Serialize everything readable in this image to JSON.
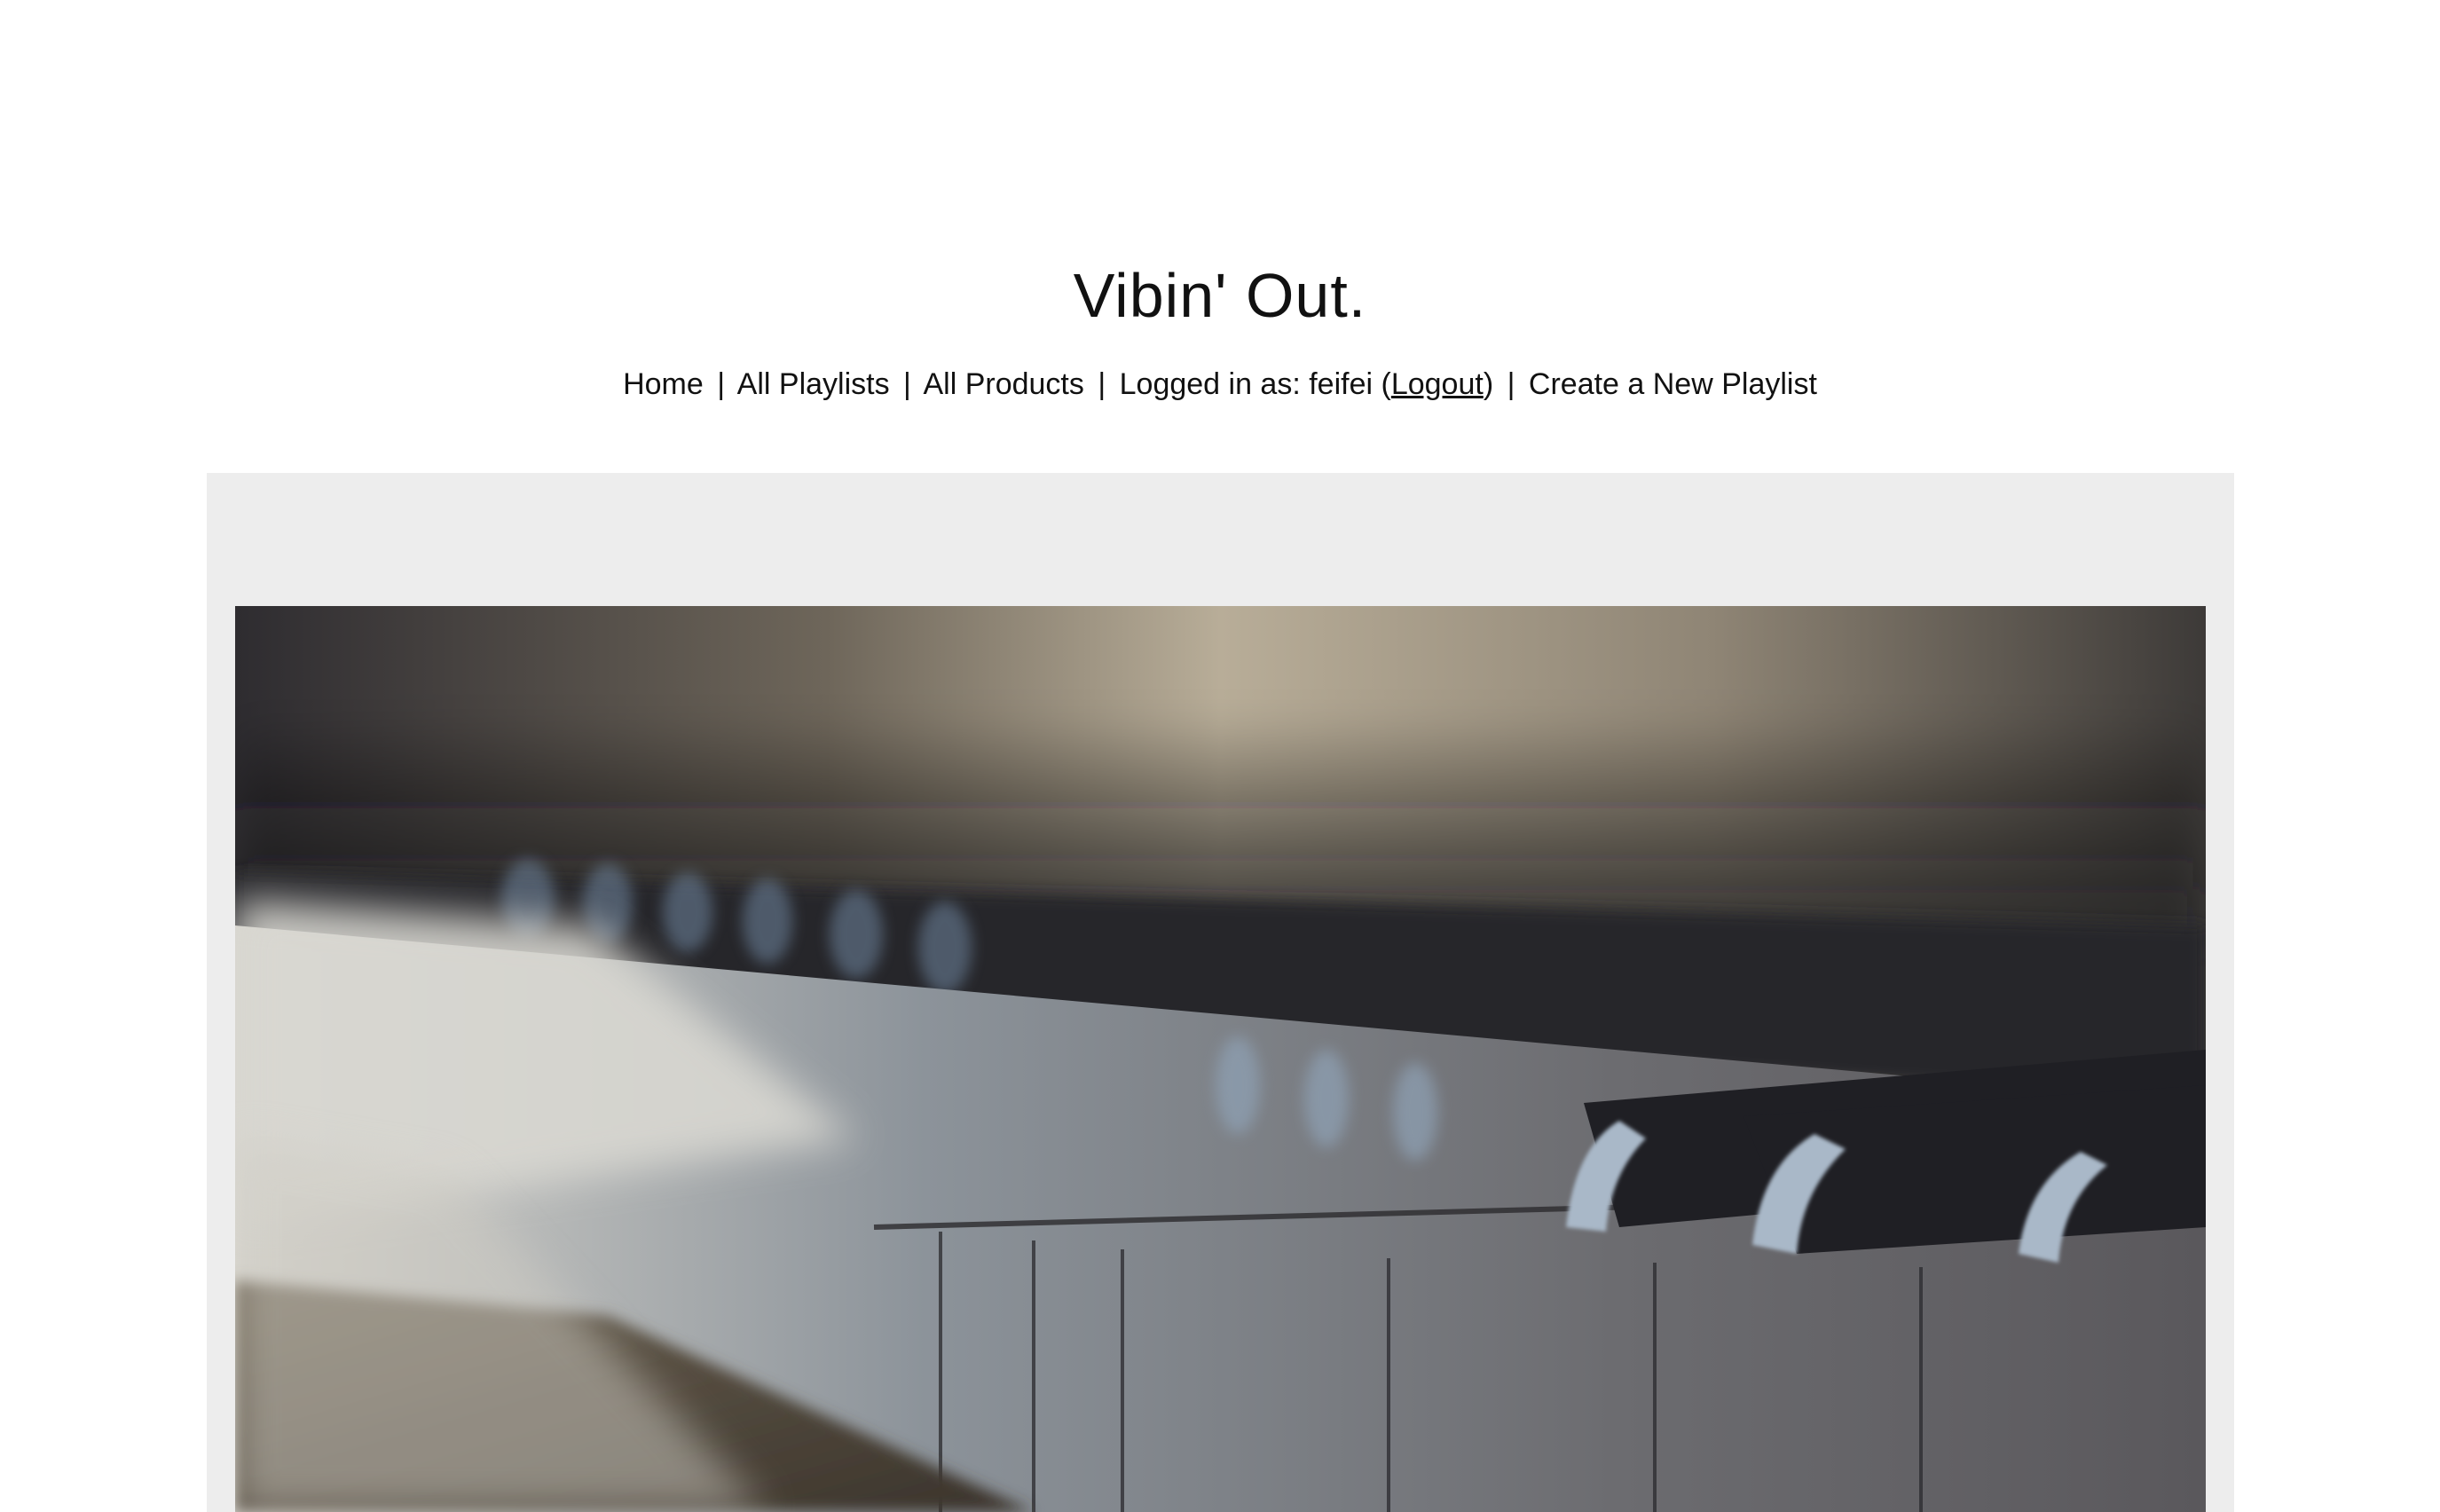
{
  "site": {
    "title": "Vibin' Out."
  },
  "nav": {
    "home": "Home",
    "all_playlists": "All Playlists",
    "all_products": "All Products",
    "logged_in_prefix": "Logged in as: feifei (",
    "logout": "Logout",
    "logged_in_suffix": ")",
    "create_playlist": "Create a New Playlist",
    "separator": "|"
  },
  "hero": {
    "image": "piano-keys-photo"
  },
  "colors": {
    "panel_background": "#ededed",
    "text": "#111111"
  }
}
